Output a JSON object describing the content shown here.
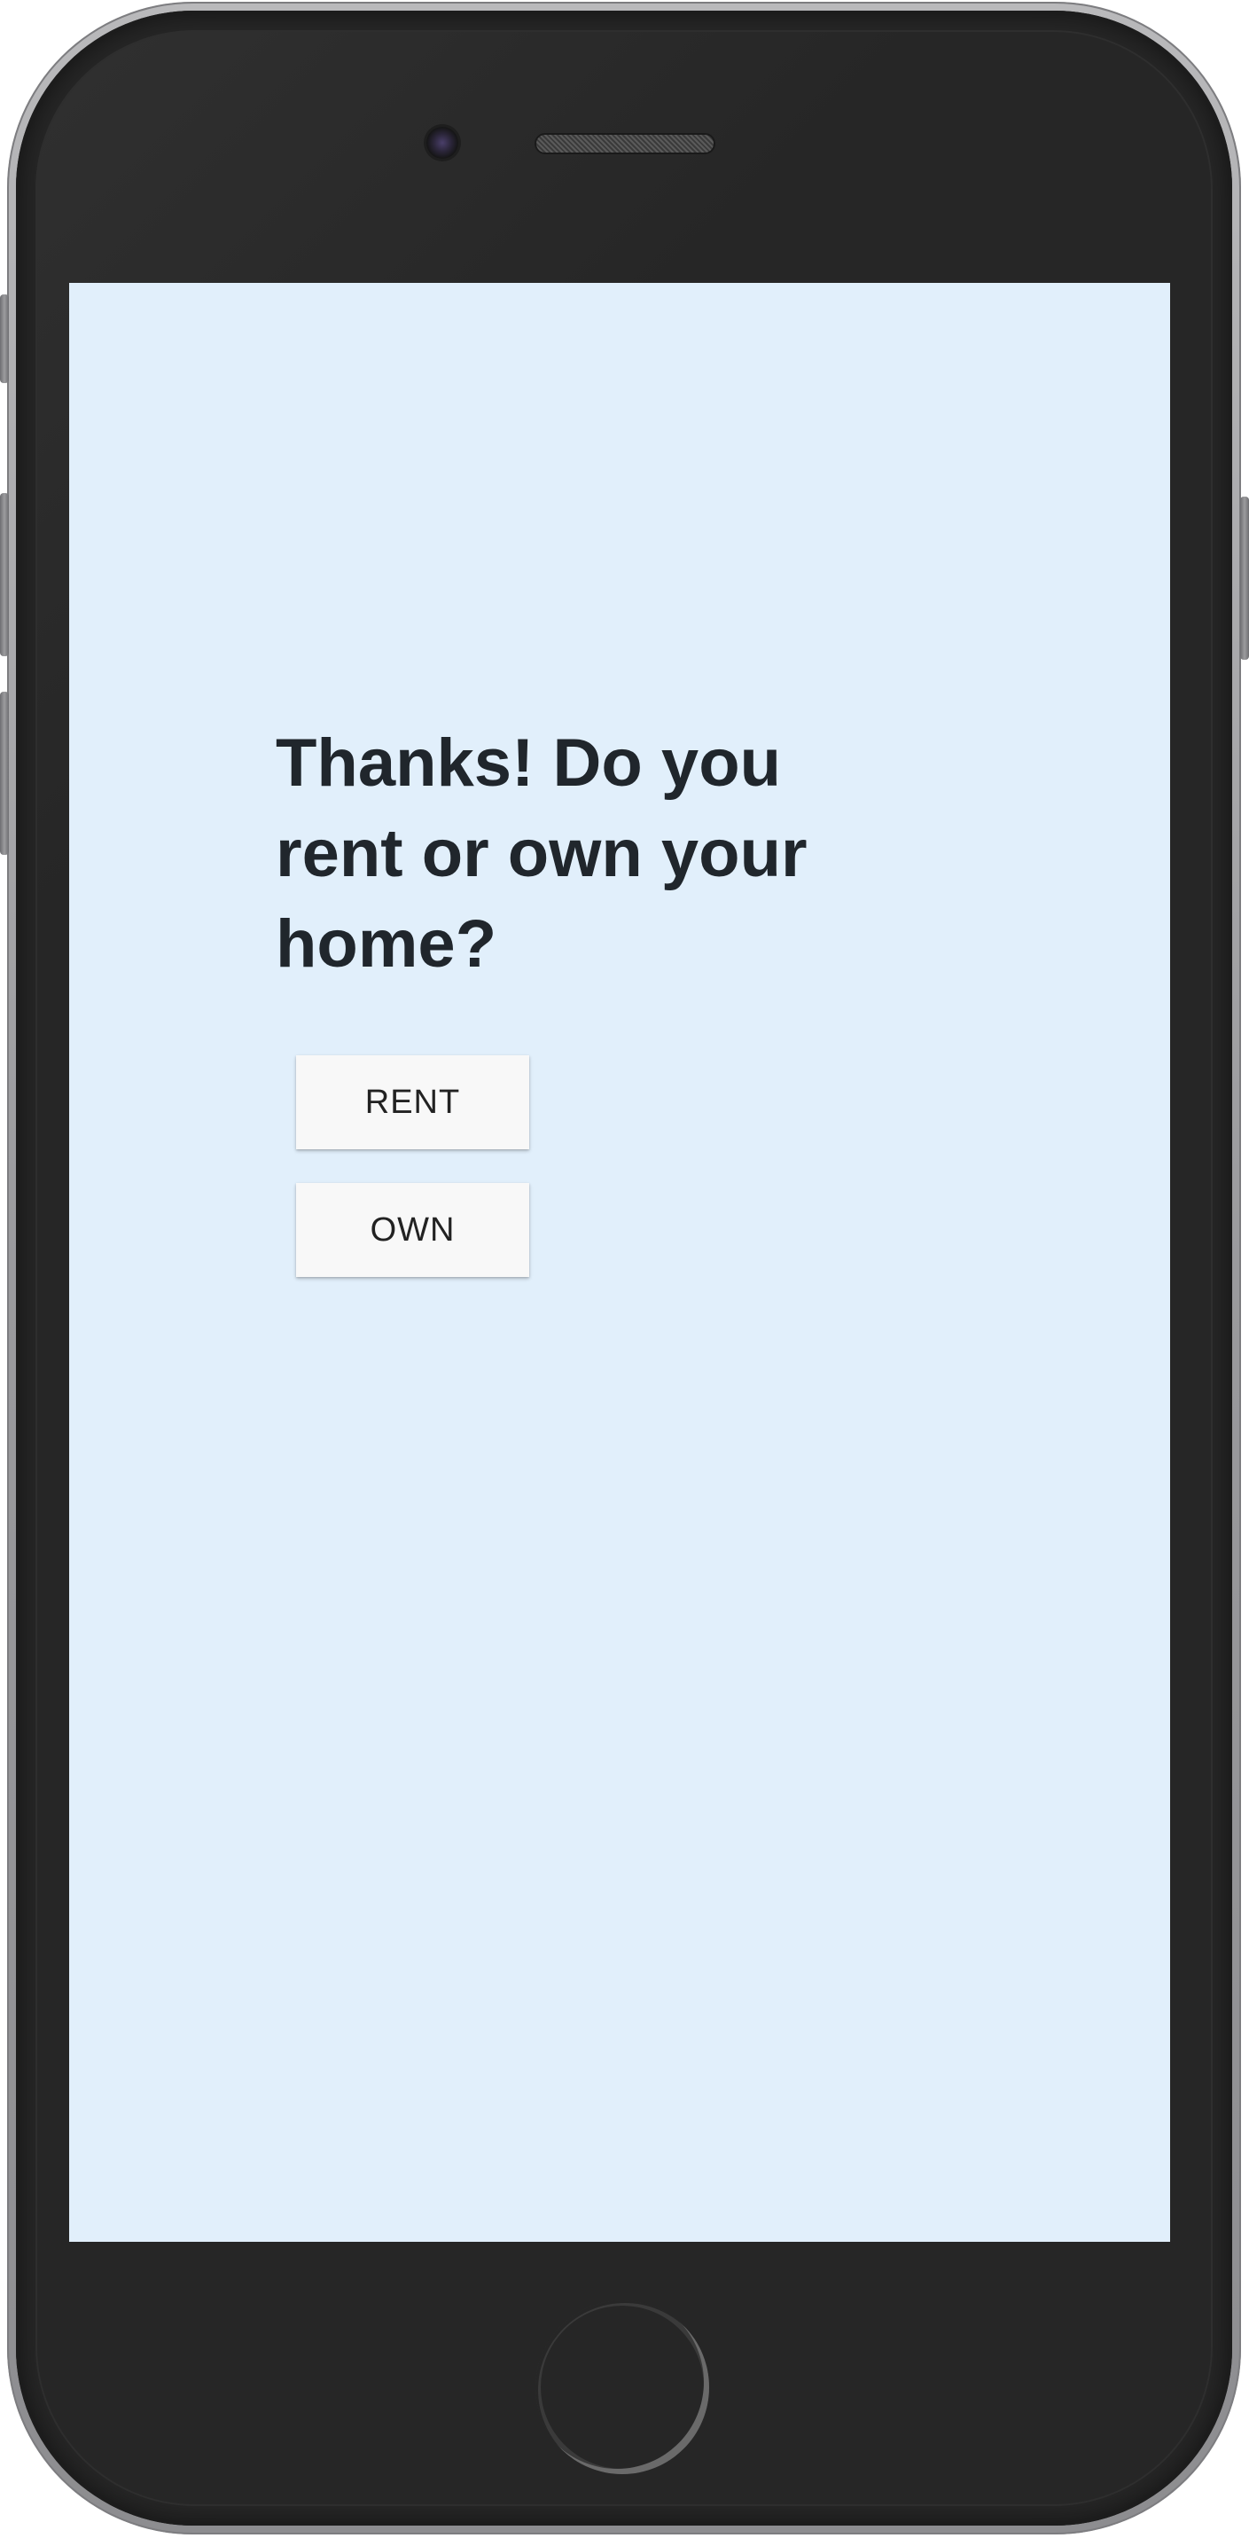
{
  "device": {
    "frame": "smartphone",
    "screen_background": "#e1effb"
  },
  "content": {
    "question": "Thanks! Do you rent or own your home?"
  },
  "choices": [
    {
      "label": "RENT"
    },
    {
      "label": "OWN"
    }
  ],
  "colors": {
    "heading": "#20262c",
    "button_background": "#f8f8f8",
    "button_text": "#222222"
  },
  "icons": {
    "camera": "camera-icon",
    "speaker": "speaker-grille-icon",
    "home": "home-button-icon"
  }
}
